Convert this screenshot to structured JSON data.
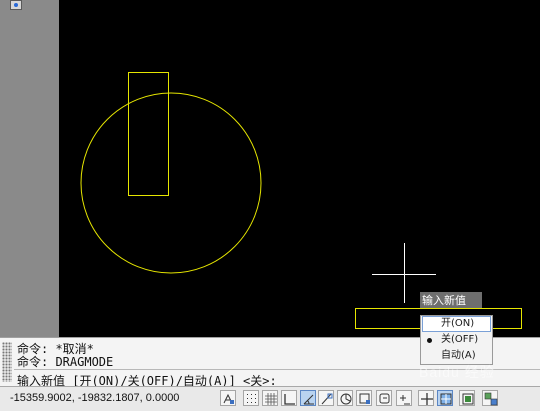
{
  "colors": {
    "canvas_bg": "#000000",
    "drawing": "#e6e600",
    "crosshair": "#ffffff"
  },
  "dynamic_input": {
    "prompt": "输入新值",
    "options": [
      "开(ON)",
      "关(OFF)",
      "自动(A)"
    ],
    "selected_index": 1
  },
  "command_line": {
    "history": [
      "命令: *取消*",
      "命令: DRAGMODE"
    ],
    "current": "输入新值 [开(ON)/关(OFF)/自动(A)] <关>:"
  },
  "status_bar": {
    "coordinates": "-15359.9002, -19832.1807, 0.0000",
    "buttons": [
      {
        "name": "infer-constraints-icon"
      },
      {
        "name": "snap-mode-icon"
      },
      {
        "name": "grid-display-icon"
      },
      {
        "name": "ortho-mode-icon"
      },
      {
        "name": "polar-tracking-icon"
      },
      {
        "name": "object-snap-icon"
      },
      {
        "name": "3d-object-snap-icon"
      },
      {
        "name": "object-snap-tracking-icon"
      },
      {
        "name": "allow-dynamic-ucs-icon"
      },
      {
        "name": "dynamic-input-icon"
      },
      {
        "name": "show-lineweight-icon"
      },
      {
        "name": "transparency-icon"
      },
      {
        "name": "quick-properties-icon"
      },
      {
        "name": "selection-cycling-icon"
      }
    ]
  },
  "watermark": "Baidu 经验"
}
